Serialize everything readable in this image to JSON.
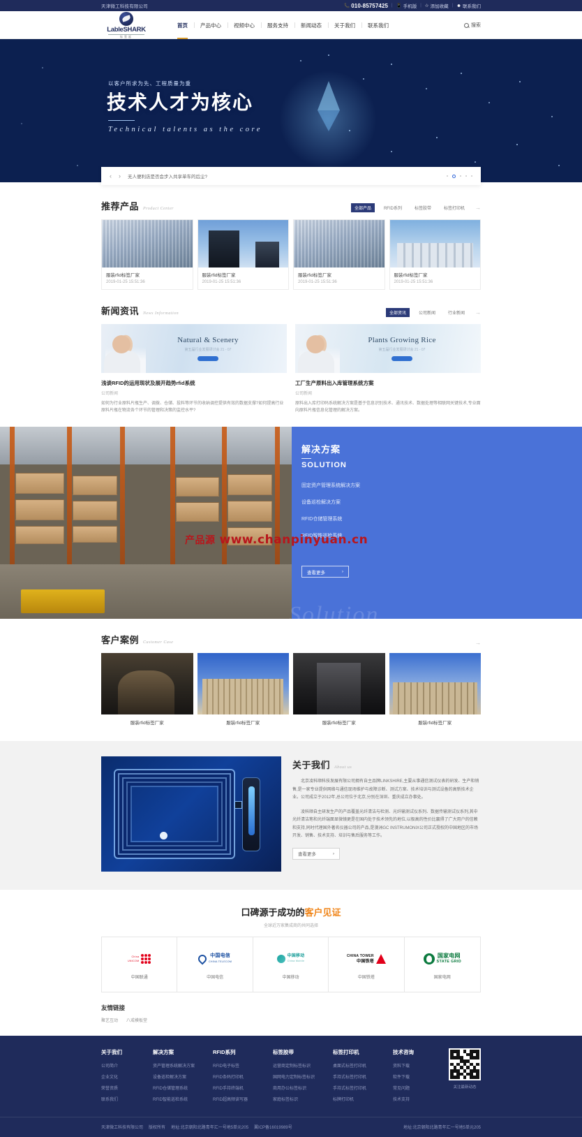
{
  "topbar": {
    "company": "天津微工科技有限公司",
    "phone": "010-85757425",
    "links": [
      "手机版",
      "添加收藏",
      "联系我们"
    ]
  },
  "header": {
    "logo_text": "LableSHARK",
    "logo_sub": "标签鲨",
    "nav": [
      "首页",
      "产品中心",
      "视频中心",
      "服务支持",
      "新闻动态",
      "关于我们",
      "联系我们"
    ],
    "search_label": "搜索"
  },
  "hero": {
    "pre_title": "以客户所求为先、工程质量为重",
    "title": "技术人才为核心",
    "en_title": "Technical talents as the core"
  },
  "notice": {
    "prev": "‹",
    "next": "›",
    "text": "无人便利店是否会步入共享单车的后尘?"
  },
  "products": {
    "title": "推荐产品",
    "subtitle": "Product Center",
    "tabs": [
      "全部产品",
      "RFID系列",
      "标签胶带",
      "标签打印机"
    ],
    "active_tab": 0,
    "more": "→",
    "items": [
      {
        "name": "服装rfid标签厂家",
        "date": "2019-01-25 15:51:36"
      },
      {
        "name": "服装rfid标签厂家",
        "date": "2019-01-25 15:51:36"
      },
      {
        "name": "服装rfid标签厂家",
        "date": "2019-01-25 15:51:36"
      },
      {
        "name": "服装rfid标签厂家",
        "date": "2019-01-25 15:51:36"
      }
    ]
  },
  "news": {
    "title": "新闻资讯",
    "subtitle": "News Information",
    "tabs": [
      "全部资讯",
      "公司新闻",
      "行业新闻"
    ],
    "active_tab": 0,
    "more": "→",
    "items": [
      {
        "cover_title": "Natural & Scenery",
        "cover_meta": "第五届行业发展研讨会 21 - 07",
        "title": "浅谈RFID的运用现状及展开趋势rfid系统",
        "tag": "公司新闻",
        "desc": "如何为行业原料片瓶生产、调拨、仓储、投料等环节的收纳调控提供有效的数据支撑?如何提高行业原料片瓶在物流各个环节的管理和决策的监控水平?"
      },
      {
        "cover_title": "Plants Growing Rice",
        "cover_meta": "第五届行业发展研讨会 21 - 07",
        "title": "工厂生产原料出入库管理系统方案",
        "tag": "公司新闻",
        "desc": "原料出入库打印码系统解决方案是基于信息识别技术、通讯技术、数据处理等相联网关键技术,专业面向原料片瓶信息化管理的解决方案。"
      }
    ]
  },
  "solution": {
    "title": "解决方案",
    "en_title": "SOLUTION",
    "ghost": "Solution",
    "items": [
      "固定资产管理系统解决方案",
      "设备巡检解决方案",
      "RFID仓储管理系统",
      "RFID智能巡检系统"
    ],
    "button": "查看更多",
    "button_arrow": "›"
  },
  "watermark": {
    "cn": "产品源",
    "url": "www.chanpinyuan.cn"
  },
  "cases": {
    "title": "客户案例",
    "subtitle": "Customer Case",
    "more": "→",
    "items": [
      {
        "name": "服装rfid标签厂家"
      },
      {
        "name": "服装rfid标签厂家"
      },
      {
        "name": "服装rfid标签厂家"
      },
      {
        "name": "服装rfid标签厂家"
      }
    ]
  },
  "about": {
    "title": "关于我们",
    "subtitle": "About us",
    "paragraphs": [
      "北京凌科顺科技发展有限公司拥有自主品牌LINKSHIRE,主要从事通信测试仪表的研发、生产和销售,是一家专业提供网络与通信现场维护与故障诊断、测试方案、技术培训与测试设备的高新技术企业。公司成立于2012年,总公司位于北京,分别在深圳、重庆成立办事处。",
      "凌科顺自主研发生产的产品覆盖光纤清洁与检测、光纤输测试仪系列、数据传输测试仪系列,其中光纤清洁笔和光纤端面显微镜更是在国内处于技术领先的地位,以极高的性价比赢得了广大用户的信赖和支持,同时代理国外著名仪器公司的产品,是澳洲GC INSTRUMONIX公司正式授权的中国地区的市场开发、销售、技术支持、培训与售后服务等工作。"
    ],
    "button": "查看更多",
    "button_arrow": "›"
  },
  "testimonial": {
    "title_plain": "口碑源于成功的",
    "title_accent": "客户见证",
    "subtitle": "全球近万家集成商的共同选择",
    "brands": [
      {
        "name": "中国联通",
        "logo_cn": "中国联通",
        "logo_en": "China Unicom"
      },
      {
        "name": "中国电信",
        "logo_cn": "中国电信",
        "logo_en": "CHINA TELECOM"
      },
      {
        "name": "中国移动",
        "logo_cn": "中国移动",
        "logo_en": "China Mobile"
      },
      {
        "name": "中国铁塔",
        "logo_cn": "中国铁塔",
        "logo_en": "CHINA TOWER"
      },
      {
        "name": "国家电网",
        "logo_cn": "国家电网",
        "logo_en": "STATE GRID"
      }
    ]
  },
  "friend_links": {
    "title": "友情链接",
    "links": [
      "聚艺互动",
      "八戒模板堂"
    ]
  },
  "footer": {
    "columns": [
      {
        "heading": "关于我们",
        "links": [
          "公司简介",
          "企业文化",
          "荣誉资质",
          "联系我们"
        ]
      },
      {
        "heading": "解决方案",
        "links": [
          "资产管理系统解决方案",
          "设备巡检解决方案",
          "RFID仓储管理系统",
          "RFID智能巡检系统"
        ]
      },
      {
        "heading": "RFID系列",
        "links": [
          "RFID电子标签",
          "RFID条码打印机",
          "RFID手持终端机",
          "RFID超高频读写器"
        ]
      },
      {
        "heading": "标签胶带",
        "links": [
          "运营商定制标签标识",
          "国网电力定制标签标识",
          "商用办公标签标识",
          "家庭标签标识"
        ]
      },
      {
        "heading": "标签打印机",
        "links": [
          "桌面式标签打印机",
          "手持式标签打印机",
          "手持式标签打印机",
          "标牌打印机"
        ]
      },
      {
        "heading": "技术咨询",
        "links": [
          "资料下载",
          "软件下载",
          "常见问题",
          "技术支持"
        ]
      }
    ],
    "qr_caption": "关注最新动态",
    "bottom_left": [
      "天津微工科技有限公司",
      "版权所有",
      "地址:北京朝阳北路青年汇一号地5单元205",
      "翼ICP备16019989号"
    ],
    "bottom_right": "地址:北京朝阳北路青年汇一号地5单元205"
  }
}
